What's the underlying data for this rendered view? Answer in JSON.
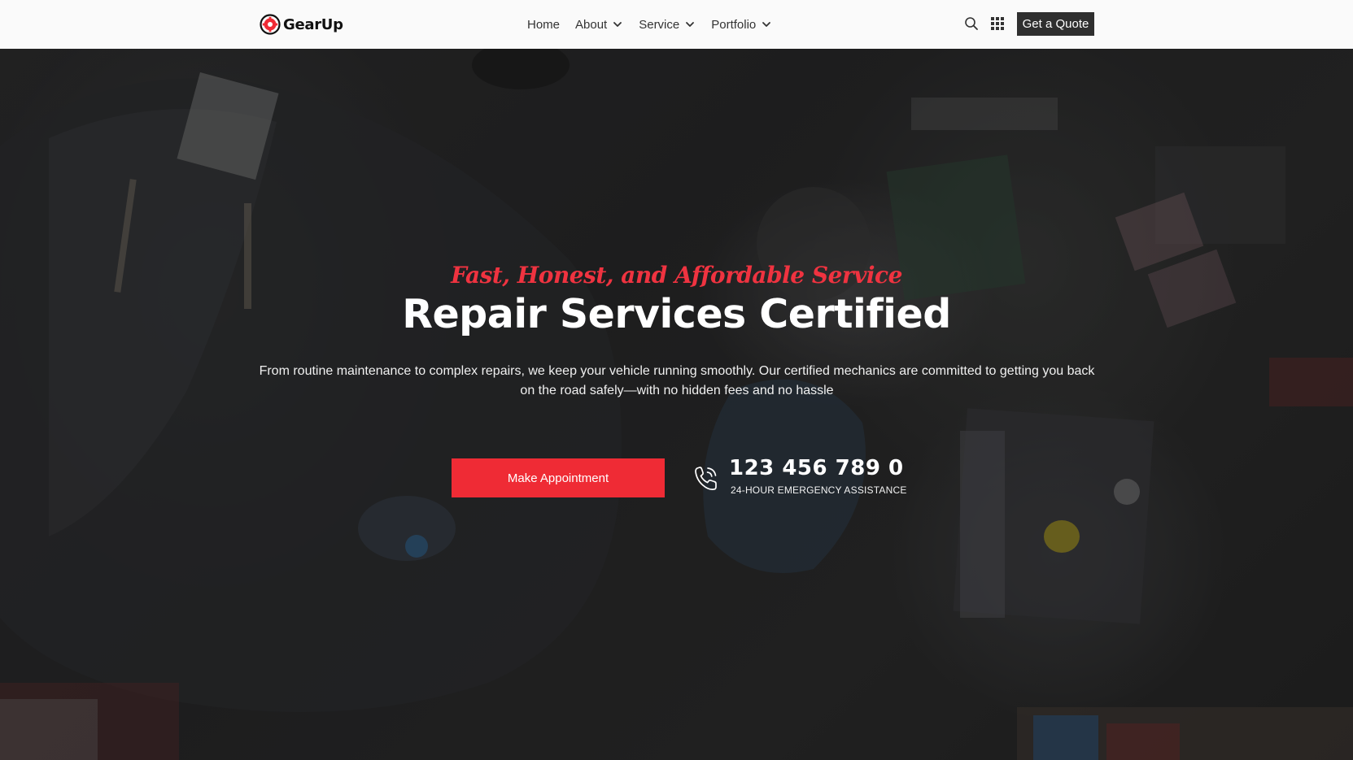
{
  "brand": {
    "name": "GearUp",
    "accent": "#ef2b35"
  },
  "nav": {
    "items": [
      {
        "label": "Home",
        "dropdown": false
      },
      {
        "label": "About",
        "dropdown": true
      },
      {
        "label": "Service",
        "dropdown": true
      },
      {
        "label": "Portfolio",
        "dropdown": true
      }
    ]
  },
  "header": {
    "search_icon": "search-icon",
    "grid_icon": "grid-menu-icon",
    "quote_label": "Get a Quote",
    "quote_bg": "#2f2f2f"
  },
  "hero": {
    "tagline": "Fast, Honest, and Affordable Service",
    "title": "Repair Services Certified",
    "description": "From routine maintenance to complex repairs, we keep your vehicle running smoothly. Our certified mechanics are committed to getting you back on the road safely—with no hidden fees and no hassle",
    "cta_label": "Make Appointment",
    "phone_icon": "phone-icon",
    "phone_number": "123 456 789 0",
    "phone_caption": "24-HOUR EMERGENCY ASSISTANCE"
  }
}
